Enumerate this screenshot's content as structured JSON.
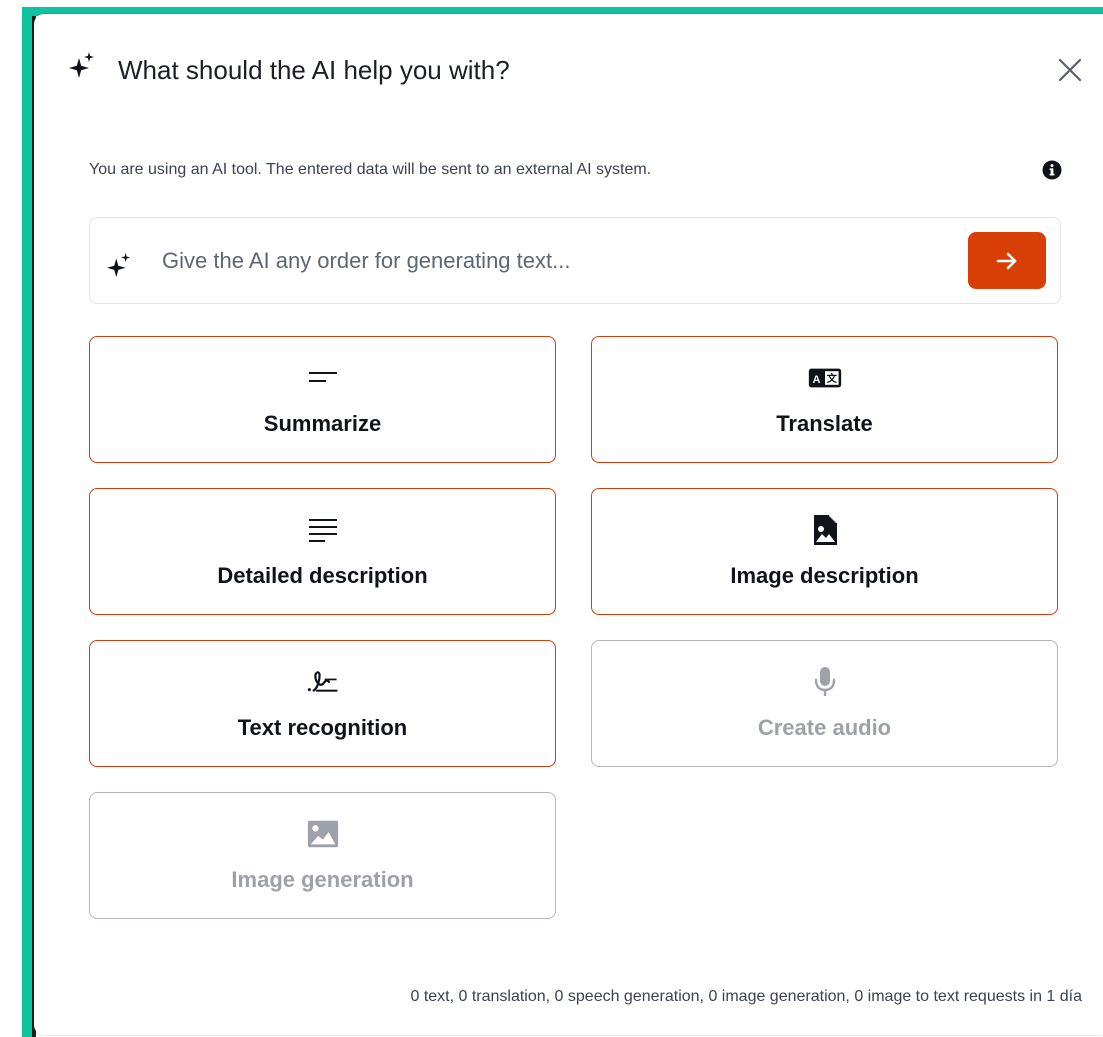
{
  "dialog": {
    "title": "What should the AI help you with?",
    "info_text": "You are using an AI tool. The entered data will be sent to an external AI system."
  },
  "prompt": {
    "placeholder": "Give the AI any order for generating text..."
  },
  "options": [
    {
      "label": "Summarize",
      "icon": "short-text-icon",
      "enabled": true
    },
    {
      "label": "Translate",
      "icon": "translate-icon",
      "enabled": true
    },
    {
      "label": "Detailed description",
      "icon": "long-text-icon",
      "enabled": true
    },
    {
      "label": "Image description",
      "icon": "image-file-icon",
      "enabled": true
    },
    {
      "label": "Text recognition",
      "icon": "signature-icon",
      "enabled": true
    },
    {
      "label": "Create audio",
      "icon": "microphone-icon",
      "enabled": false
    },
    {
      "label": "Image generation",
      "icon": "image-icon",
      "enabled": false
    }
  ],
  "footer": {
    "quota_text": "0 text, 0 translation, 0 speech generation, 0 image generation, 0 image to text requests in 1 día"
  },
  "colors": {
    "accent": "#d83f07",
    "frame": "#10c3a0",
    "disabled": "#9ea2a8"
  }
}
